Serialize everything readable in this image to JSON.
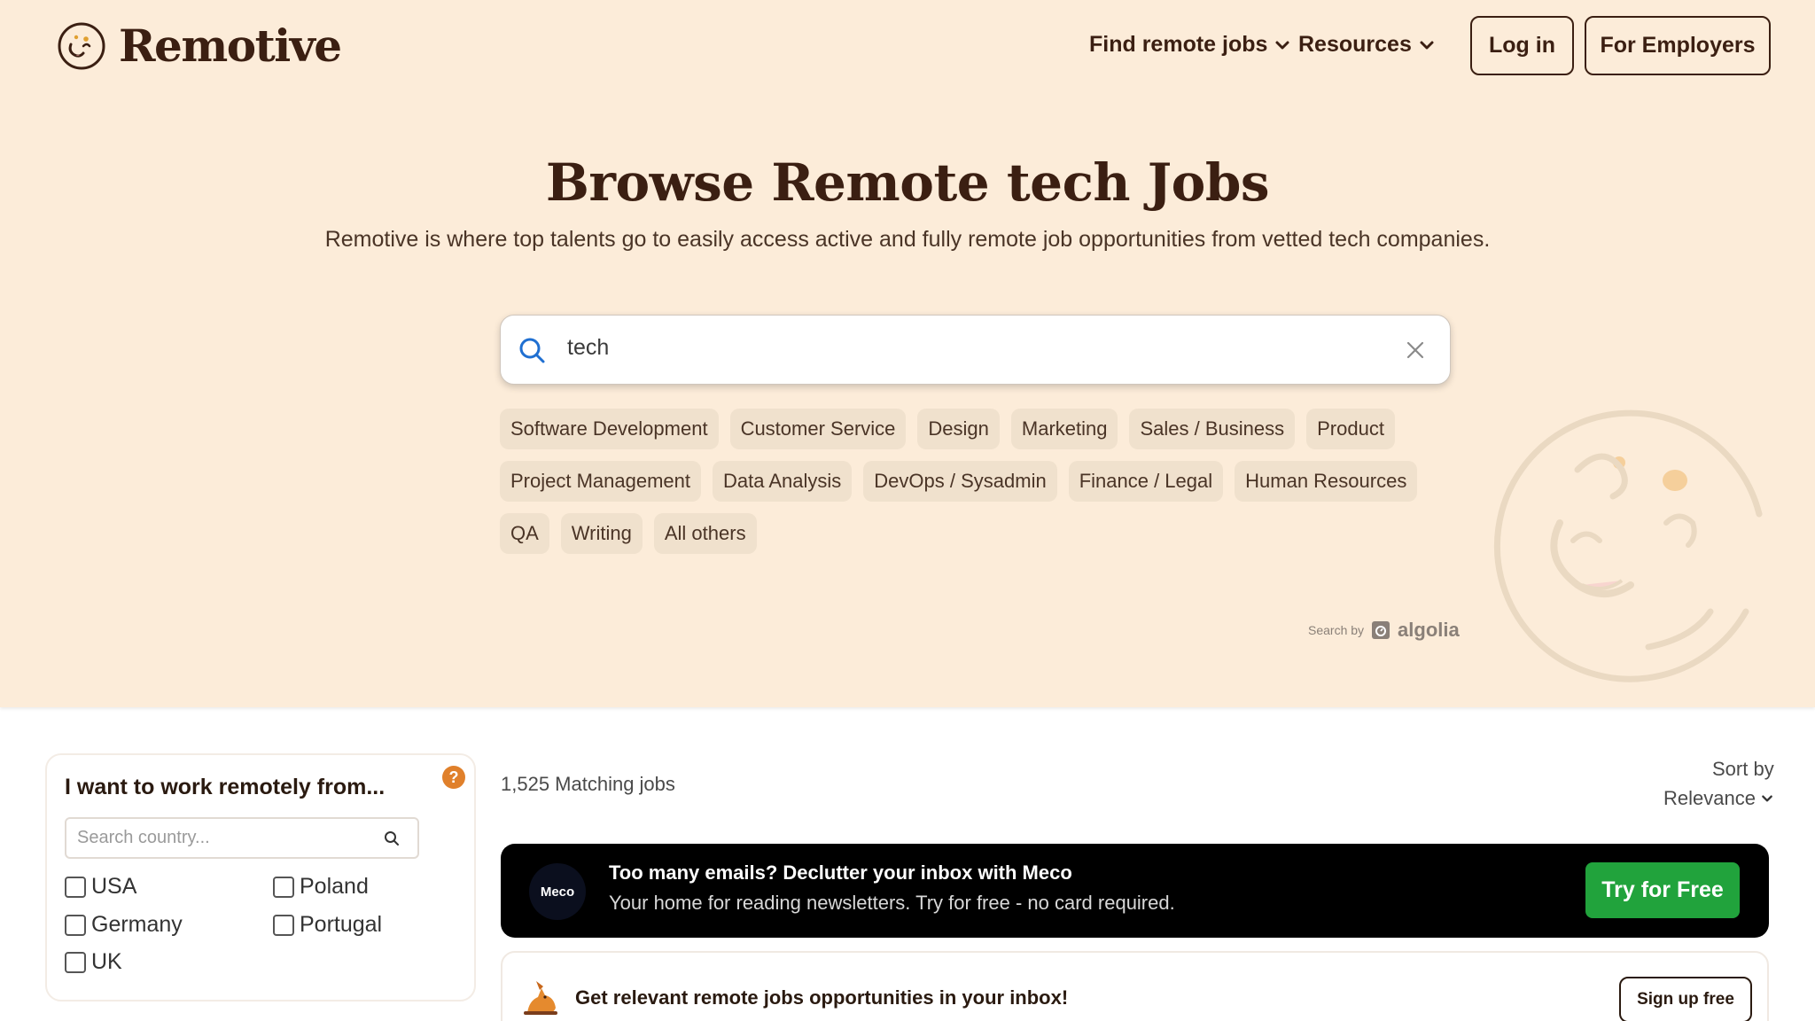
{
  "header": {
    "logo_text": "Remotive",
    "nav": [
      {
        "label": "Find remote jobs"
      },
      {
        "label": "Resources"
      }
    ],
    "login_label": "Log in",
    "employers_label": "For Employers"
  },
  "hero": {
    "title": "Browse Remote tech Jobs",
    "subtitle": "Remotive is where top talents go to easily access active and fully remote job opportunities from vetted tech companies.",
    "search_value": "tech",
    "tags": [
      "Software Development",
      "Customer Service",
      "Design",
      "Marketing",
      "Sales / Business",
      "Product",
      "Project Management",
      "Data Analysis",
      "DevOps / Sysadmin",
      "Finance / Legal",
      "Human Resources",
      "QA",
      "Writing",
      "All others"
    ],
    "search_by": "Search by",
    "algolia": "algolia"
  },
  "filter": {
    "title": "I want to work remotely from...",
    "help": "?",
    "search_placeholder": "Search country...",
    "countries": [
      "USA",
      "Poland",
      "Germany",
      "Portugal",
      "UK"
    ]
  },
  "results": {
    "count": "1,525 Matching jobs",
    "sort_label": "Sort by",
    "sort_value": "Relevance"
  },
  "promo": {
    "logo": "Meco",
    "title": "Too many emails? Declutter your inbox with Meco",
    "subtitle": "Your home for reading newsletters. Try for free - no card required.",
    "cta": "Try for Free"
  },
  "signup": {
    "text": "Get relevant remote jobs opportunities in your inbox!",
    "cta": "Sign up free"
  },
  "colors": {
    "hero_bg": "#fcecd9",
    "brand_dark": "#3b1f12",
    "tag_bg": "#f0e1cd",
    "cta_green": "#21a33c",
    "help_orange": "#e0802b"
  }
}
